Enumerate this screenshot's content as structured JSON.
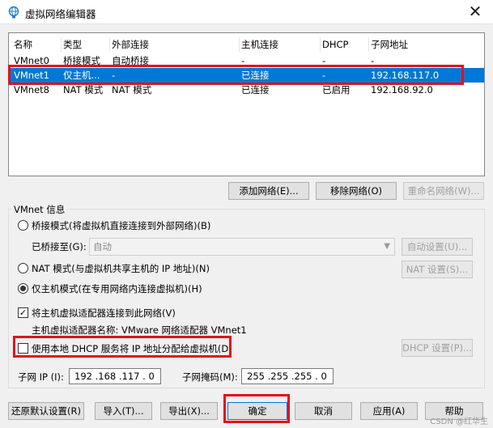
{
  "window": {
    "title": "虚拟网络编辑器",
    "close": "✕"
  },
  "table": {
    "headers": [
      "名称",
      "类型",
      "外部连接",
      "主机连接",
      "DHCP",
      "子网地址"
    ],
    "rows": [
      [
        "VMnet0",
        "桥接模式",
        "自动桥接",
        "-",
        "-",
        "-"
      ],
      [
        "VMnet1",
        "仅主机...",
        "-",
        "已连接",
        "-",
        "192.168.117.0"
      ],
      [
        "VMnet8",
        "NAT 模式",
        "NAT 模式",
        "已连接",
        "已启用",
        "192.168.92.0"
      ]
    ],
    "selected_row": 1
  },
  "network_buttons": {
    "add": "添加网络(E)...",
    "remove": "移除网络(O)",
    "rename": "重命名网络(W)..."
  },
  "vmnet_info": {
    "label": "VMnet 信息",
    "bridged": {
      "label": "桥接模式(将虚拟机直接连接到外部网络)(B)",
      "bridged_to_label": "已桥接至(G):",
      "bridged_to_value": "自动",
      "auto_settings": "自动设置(U)..."
    },
    "nat": {
      "label": "NAT 模式(与虚拟机共享主机的 IP 地址)(N)",
      "settings": "NAT 设置(S)..."
    },
    "hostonly": {
      "label": "仅主机模式(在专用网络内连接虚拟机)(H)"
    },
    "selected_mode": "hostonly",
    "connect_adapter": {
      "label": "将主机虚拟适配器连接到此网络(V)",
      "checked": true,
      "check_mark": "✓"
    },
    "adapter_name_label": "主机虚拟适配器名称: VMware 网络适配器 VMnet1",
    "dhcp": {
      "label": "使用本地 DHCP 服务将 IP 地址分配给虚拟机(D)",
      "checked": false,
      "settings": "DHCP 设置(P)..."
    },
    "subnet_ip_label": "子网 IP (I):",
    "subnet_ip": "192 .168 .117 .  0",
    "subnet_mask_label": "子网掩码(M):",
    "subnet_mask": "255 .255 .255 .  0"
  },
  "footer": {
    "restore": "还原默认设置(R)",
    "import": "导入(T)...",
    "export": "导出(X)...",
    "ok": "确定",
    "cancel": "取消",
    "apply": "应用(A)",
    "help": "帮助"
  },
  "watermark": "CSDN @红华生",
  "colors": {
    "selection": "#0078d7",
    "highlight_box": "#e1101c",
    "icon": "#1a7fd4"
  }
}
